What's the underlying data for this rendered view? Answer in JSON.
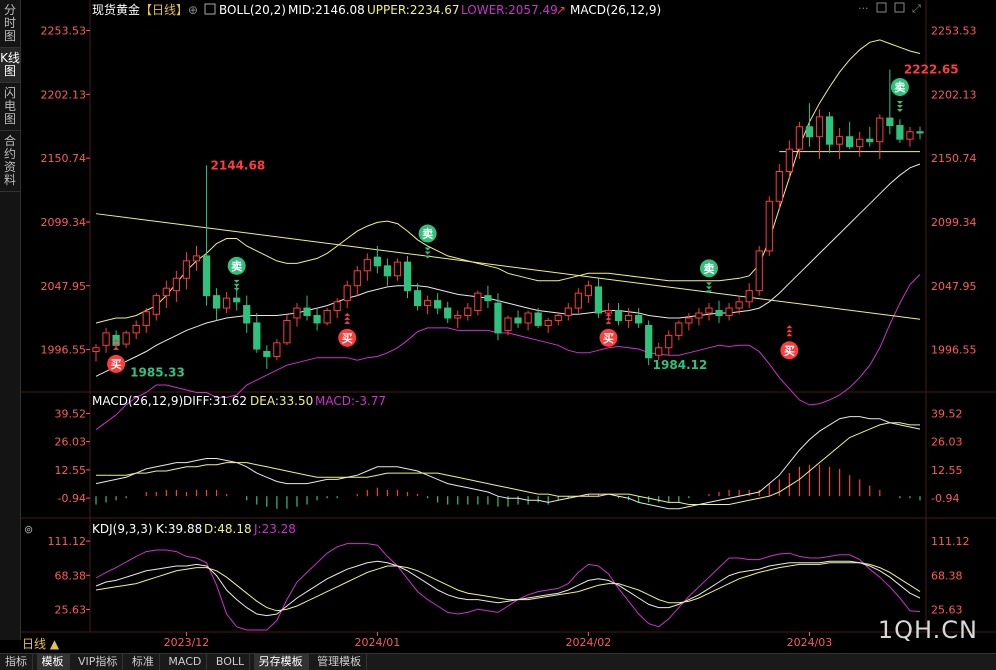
{
  "sidebar": {
    "tabs": [
      "分时图",
      "K线图",
      "闪电图",
      "合约资料"
    ],
    "active": 1
  },
  "header": {
    "symbol": "现货黄金",
    "period_tag": "【日线】",
    "boll": "BOLL(20,2)",
    "mid": "MID:2146.08",
    "upper": "UPPER:2234.67",
    "lower": "LOWER:2057.49",
    "macd": "MACD(26,12,9)"
  },
  "macd_header": {
    "title": "MACD(26,12,9)",
    "diff": "DIFF:31.62",
    "dea": "DEA:33.50",
    "macd": "MACD:-3.77"
  },
  "kdj_header": {
    "title": "KDJ(9,3,3)",
    "k": "K:39.88",
    "d": "D:48.18",
    "j": "J:23.28"
  },
  "period_label": "日线",
  "watermark": "1QH.CN",
  "bottom_tabs": [
    "指标",
    "模板",
    "VIP指标",
    "标准",
    "MACD",
    "BOLL",
    "另存模板",
    "管理模板"
  ],
  "bottom_active": [
    1,
    6
  ],
  "colors": {
    "up": "#ff3b3b",
    "down": "#2ec27e",
    "boll": "#f2f27a",
    "lower": "#d02fd0",
    "bg": "#000000"
  },
  "chart_data": {
    "type": "candlestick",
    "x_labels": [
      "2023/12",
      "2024/01",
      "2024/02",
      "2024/03"
    ],
    "x_label_index": [
      9,
      28,
      49,
      71
    ],
    "price": {
      "yticks": [
        1996.55,
        2047.95,
        2099.34,
        2150.74,
        2202.13,
        2253.53
      ],
      "ylim": [
        1964,
        2262
      ],
      "ohlc": [
        [
          1995,
          2001,
          1987,
          1998
        ],
        [
          2000,
          2014,
          1994,
          2010
        ],
        [
          2008,
          2012,
          1997,
          2000
        ],
        [
          2001,
          2012,
          1998,
          2010
        ],
        [
          2010,
          2020,
          2005,
          2016
        ],
        [
          2016,
          2030,
          2010,
          2027
        ],
        [
          2025,
          2042,
          2020,
          2040
        ],
        [
          2040,
          2052,
          2030,
          2046
        ],
        [
          2044,
          2060,
          2035,
          2054
        ],
        [
          2054,
          2075,
          2045,
          2068
        ],
        [
          2068,
          2080,
          2060,
          2072
        ],
        [
          2072,
          2145,
          2032,
          2040
        ],
        [
          2040,
          2046,
          2020,
          2030
        ],
        [
          2030,
          2043,
          2026,
          2038
        ],
        [
          2038,
          2048,
          2028,
          2035
        ],
        [
          2032,
          2040,
          2010,
          2018
        ],
        [
          2018,
          2026,
          1994,
          1997
        ],
        [
          1995,
          2000,
          1981,
          1991
        ],
        [
          1991,
          2005,
          1988,
          2002
        ],
        [
          2002,
          2025,
          2000,
          2020
        ],
        [
          2022,
          2034,
          2015,
          2030
        ],
        [
          2030,
          2040,
          2020,
          2024
        ],
        [
          2024,
          2030,
          2012,
          2018
        ],
        [
          2018,
          2030,
          2016,
          2028
        ],
        [
          2028,
          2038,
          2022,
          2035
        ],
        [
          2036,
          2052,
          2030,
          2048
        ],
        [
          2048,
          2064,
          2040,
          2060
        ],
        [
          2060,
          2074,
          2052,
          2069
        ],
        [
          2071,
          2080,
          2058,
          2064
        ],
        [
          2064,
          2070,
          2048,
          2056
        ],
        [
          2056,
          2070,
          2052,
          2067
        ],
        [
          2067,
          2072,
          2038,
          2044
        ],
        [
          2044,
          2050,
          2028,
          2032
        ],
        [
          2032,
          2040,
          2025,
          2036
        ],
        [
          2036,
          2042,
          2025,
          2030
        ],
        [
          2030,
          2035,
          2018,
          2022
        ],
        [
          2022,
          2028,
          2014,
          2024
        ],
        [
          2024,
          2034,
          2020,
          2030
        ],
        [
          2028,
          2044,
          2024,
          2042
        ],
        [
          2040,
          2048,
          2030,
          2036
        ],
        [
          2034,
          2042,
          2004,
          2010
        ],
        [
          2012,
          2024,
          2008,
          2022
        ],
        [
          2022,
          2028,
          2014,
          2018
        ],
        [
          2018,
          2028,
          2012,
          2026
        ],
        [
          2026,
          2030,
          2014,
          2016
        ],
        [
          2016,
          2022,
          2010,
          2020
        ],
        [
          2020,
          2026,
          2016,
          2024
        ],
        [
          2024,
          2034,
          2020,
          2030
        ],
        [
          2030,
          2046,
          2026,
          2042
        ],
        [
          2040,
          2052,
          2034,
          2048
        ],
        [
          2047,
          2054,
          2022,
          2026
        ],
        [
          2026,
          2034,
          2020,
          2028
        ],
        [
          2028,
          2034,
          2016,
          2020
        ],
        [
          2020,
          2030,
          2014,
          2024
        ],
        [
          2024,
          2030,
          2014,
          2018
        ],
        [
          2016,
          2020,
          1984,
          1990
        ],
        [
          1992,
          2002,
          1988,
          1998
        ],
        [
          1998,
          2012,
          1992,
          2008
        ],
        [
          2008,
          2020,
          2004,
          2018
        ],
        [
          2018,
          2026,
          2012,
          2022
        ],
        [
          2022,
          2030,
          2016,
          2026
        ],
        [
          2026,
          2034,
          2020,
          2030
        ],
        [
          2028,
          2036,
          2018,
          2024
        ],
        [
          2024,
          2034,
          2020,
          2030
        ],
        [
          2030,
          2040,
          2025,
          2035
        ],
        [
          2035,
          2050,
          2030,
          2044
        ],
        [
          2044,
          2080,
          2040,
          2076
        ],
        [
          2076,
          2120,
          2072,
          2116
        ],
        [
          2116,
          2146,
          2110,
          2140
        ],
        [
          2140,
          2165,
          2135,
          2158
        ],
        [
          2158,
          2180,
          2150,
          2176
        ],
        [
          2176,
          2195,
          2160,
          2168
        ],
        [
          2168,
          2190,
          2150,
          2184
        ],
        [
          2184,
          2188,
          2155,
          2162
        ],
        [
          2162,
          2175,
          2150,
          2168
        ],
        [
          2168,
          2180,
          2158,
          2160
        ],
        [
          2160,
          2172,
          2152,
          2166
        ],
        [
          2166,
          2176,
          2160,
          2164
        ],
        [
          2164,
          2186,
          2150,
          2183
        ],
        [
          2183,
          2222,
          2170,
          2177
        ],
        [
          2177,
          2182,
          2163,
          2166
        ],
        [
          2166,
          2176,
          2160,
          2172
        ],
        [
          2172,
          2176,
          2166,
          2171
        ]
      ],
      "boll_mid": [
        1975,
        1979,
        1983,
        1987,
        1991,
        1995,
        2000,
        2004,
        2008,
        2012,
        2015,
        2018,
        2020,
        2022,
        2023,
        2024,
        2024,
        2024,
        2024,
        2025,
        2026,
        2028,
        2030,
        2032,
        2035,
        2038,
        2040,
        2043,
        2045,
        2047,
        2048,
        2048,
        2048,
        2047,
        2045,
        2043,
        2041,
        2040,
        2039,
        2038,
        2036,
        2034,
        2032,
        2030,
        2028,
        2027,
        2026,
        2025,
        2025,
        2026,
        2027,
        2028,
        2028,
        2027,
        2026,
        2024,
        2023,
        2022,
        2022,
        2023,
        2024,
        2025,
        2026,
        2026,
        2027,
        2028,
        2030,
        2035,
        2042,
        2050,
        2058,
        2066,
        2074,
        2082,
        2090,
        2098,
        2106,
        2114,
        2122,
        2130,
        2137,
        2143,
        2146
      ],
      "boll_upper": [
        2018,
        2020,
        2022,
        2022,
        2024,
        2028,
        2032,
        2040,
        2050,
        2060,
        2068,
        2074,
        2082,
        2086,
        2086,
        2080,
        2076,
        2072,
        2068,
        2066,
        2066,
        2068,
        2070,
        2074,
        2080,
        2086,
        2092,
        2096,
        2099,
        2100,
        2098,
        2092,
        2085,
        2080,
        2076,
        2072,
        2070,
        2068,
        2066,
        2064,
        2062,
        2058,
        2056,
        2054,
        2052,
        2052,
        2052,
        2054,
        2056,
        2058,
        2058,
        2058,
        2057,
        2056,
        2055,
        2054,
        2053,
        2052,
        2052,
        2052,
        2052,
        2052,
        2052,
        2053,
        2054,
        2056,
        2065,
        2085,
        2110,
        2135,
        2160,
        2180,
        2195,
        2208,
        2220,
        2230,
        2238,
        2244,
        2246,
        2243,
        2240,
        2237,
        2235
      ],
      "boll_lower": [
        1932,
        1938,
        1944,
        1952,
        1958,
        1962,
        1968,
        1968,
        1966,
        1964,
        1962,
        1962,
        1958,
        1958,
        1960,
        1968,
        1972,
        1976,
        1980,
        1984,
        1986,
        1988,
        1990,
        1990,
        1990,
        1990,
        1988,
        1990,
        1991,
        1994,
        1998,
        2004,
        2011,
        2014,
        2014,
        2014,
        2012,
        2012,
        2012,
        2012,
        2010,
        2010,
        2008,
        2006,
        2004,
        2002,
        2000,
        1996,
        1994,
        1994,
        1996,
        1998,
        1999,
        1998,
        1997,
        1994,
        1993,
        1992,
        1992,
        1994,
        1996,
        1998,
        2000,
        1999,
        2000,
        2000,
        1995,
        1985,
        1974,
        1965,
        1956,
        1952,
        1953,
        1956,
        1960,
        1966,
        1974,
        1984,
        1998,
        2017,
        2034,
        2049,
        2057
      ],
      "trendline": {
        "from": [
          0,
          2106
        ],
        "to": [
          82,
          2021
        ]
      },
      "support_line": {
        "from": [
          68,
          2156
        ],
        "to": [
          82,
          2156
        ]
      },
      "annotations": [
        {
          "text": "2144.68",
          "i": 11,
          "price": 2145,
          "color": "#ff3b3b"
        },
        {
          "text": "1985.33",
          "i": 3,
          "price": 1978,
          "color": "#2ec27e"
        },
        {
          "text": "1984.12",
          "i": 55,
          "price": 1984,
          "color": "#2ec27e"
        },
        {
          "text": "2222.65",
          "i": 80,
          "price": 2222,
          "color": "#ff3b3b"
        }
      ],
      "signals": [
        {
          "label": "卖",
          "type": "sell",
          "i": 14,
          "price": 2064
        },
        {
          "label": "买",
          "type": "buy",
          "i": 2,
          "price": 1985
        },
        {
          "label": "买",
          "type": "buy",
          "i": 25,
          "price": 2006
        },
        {
          "label": "卖",
          "type": "sell",
          "i": 33,
          "price": 2090
        },
        {
          "label": "买",
          "type": "buy",
          "i": 51,
          "price": 2006
        },
        {
          "label": "卖",
          "type": "sell",
          "i": 61,
          "price": 2062
        },
        {
          "label": "买",
          "type": "buy",
          "i": 69,
          "price": 1996
        },
        {
          "label": "卖",
          "type": "sell",
          "i": 80,
          "price": 2208
        }
      ]
    },
    "macd": {
      "yticks": [
        39.52,
        26.03,
        12.55,
        -0.94
      ],
      "ylim": [
        -9,
        44
      ],
      "diff": [
        6,
        7,
        8,
        9,
        11,
        13,
        14,
        15,
        16,
        16,
        17,
        18,
        18,
        17,
        16,
        14,
        11,
        9,
        7,
        6,
        6,
        6,
        7,
        8,
        8,
        9,
        10,
        12,
        14,
        14,
        14,
        13,
        12,
        10,
        8,
        6,
        5,
        4,
        3,
        2,
        0,
        -1,
        -1,
        -2,
        -2,
        -3,
        -2,
        -1,
        0,
        1,
        1,
        1,
        0,
        -1,
        -3,
        -4,
        -5,
        -6,
        -6,
        -5,
        -4,
        -3,
        -2,
        -1,
        0,
        1,
        2,
        6,
        10,
        16,
        22,
        27,
        31,
        34,
        37,
        38,
        38,
        37,
        37,
        35,
        34,
        33,
        32
      ],
      "dea": [
        10,
        10,
        10,
        10,
        11,
        11,
        12,
        12,
        13,
        14,
        14,
        15,
        15,
        16,
        16,
        16,
        15,
        14,
        13,
        12,
        11,
        10,
        9,
        9,
        9,
        9,
        9,
        9,
        10,
        11,
        11,
        11,
        11,
        11,
        11,
        10,
        9,
        8,
        7,
        6,
        5,
        4,
        3,
        2,
        1,
        1,
        0,
        0,
        0,
        0,
        0,
        1,
        1,
        1,
        0,
        -1,
        -2,
        -3,
        -3,
        -4,
        -4,
        -4,
        -4,
        -4,
        -3,
        -2,
        -1,
        0,
        2,
        5,
        8,
        12,
        16,
        20,
        24,
        28,
        30,
        32,
        34,
        35,
        35,
        34,
        34
      ],
      "hist": [
        -4,
        -3,
        -2,
        -1,
        0,
        2,
        2,
        3,
        3,
        2,
        3,
        3,
        3,
        1,
        0,
        -2,
        -4,
        -5,
        -6,
        -6,
        -5,
        -4,
        -2,
        -1,
        -1,
        0,
        1,
        3,
        4,
        3,
        3,
        2,
        1,
        -1,
        -3,
        -4,
        -4,
        -4,
        -4,
        -4,
        -5,
        -5,
        -4,
        -4,
        -3,
        -4,
        -2,
        -1,
        0,
        1,
        1,
        0,
        -1,
        -2,
        -3,
        -3,
        -3,
        -3,
        -3,
        -1,
        0,
        1,
        2,
        3,
        3,
        3,
        3,
        6,
        8,
        11,
        14,
        15,
        15,
        14,
        13,
        10,
        8,
        5,
        3,
        0,
        -1,
        -1,
        -2
      ]
    },
    "kdj": {
      "yticks": [
        111.12,
        68.38,
        25.63
      ],
      "ylim": [
        0,
        125
      ],
      "k": [
        55,
        60,
        62,
        66,
        70,
        74,
        76,
        78,
        80,
        80,
        82,
        80,
        68,
        50,
        38,
        28,
        20,
        18,
        20,
        30,
        40,
        48,
        56,
        64,
        70,
        76,
        80,
        84,
        86,
        84,
        80,
        74,
        66,
        58,
        50,
        44,
        40,
        38,
        38,
        36,
        34,
        36,
        38,
        40,
        42,
        44,
        46,
        50,
        56,
        62,
        64,
        62,
        56,
        48,
        40,
        32,
        28,
        28,
        32,
        38,
        44,
        52,
        60,
        68,
        72,
        74,
        76,
        80,
        82,
        84,
        84,
        84,
        84,
        86,
        86,
        86,
        84,
        80,
        74,
        66,
        56,
        46,
        40
      ],
      "d": [
        50,
        52,
        54,
        56,
        58,
        62,
        66,
        70,
        74,
        76,
        78,
        78,
        74,
        66,
        56,
        46,
        36,
        28,
        24,
        26,
        30,
        36,
        42,
        48,
        54,
        60,
        66,
        72,
        76,
        80,
        80,
        78,
        74,
        68,
        62,
        56,
        50,
        46,
        44,
        42,
        40,
        38,
        38,
        38,
        40,
        42,
        44,
        46,
        48,
        52,
        56,
        58,
        58,
        54,
        50,
        44,
        38,
        34,
        34,
        36,
        40,
        46,
        52,
        58,
        64,
        68,
        72,
        75,
        78,
        80,
        82,
        82,
        82,
        84,
        84,
        84,
        84,
        82,
        78,
        72,
        64,
        56,
        48
      ],
      "j": [
        65,
        72,
        78,
        85,
        92,
        98,
        100,
        100,
        98,
        92,
        90,
        84,
        56,
        20,
        4,
        -6,
        -10,
        -2,
        12,
        38,
        60,
        72,
        84,
        96,
        104,
        108,
        108,
        108,
        106,
        92,
        80,
        64,
        48,
        38,
        30,
        22,
        20,
        22,
        26,
        24,
        22,
        30,
        38,
        44,
        48,
        50,
        52,
        58,
        72,
        82,
        80,
        70,
        52,
        36,
        20,
        8,
        4,
        14,
        28,
        42,
        54,
        66,
        78,
        90,
        90,
        88,
        88,
        92,
        95,
        96,
        92,
        90,
        90,
        92,
        94,
        94,
        88,
        76,
        66,
        54,
        40,
        24,
        23
      ]
    }
  }
}
